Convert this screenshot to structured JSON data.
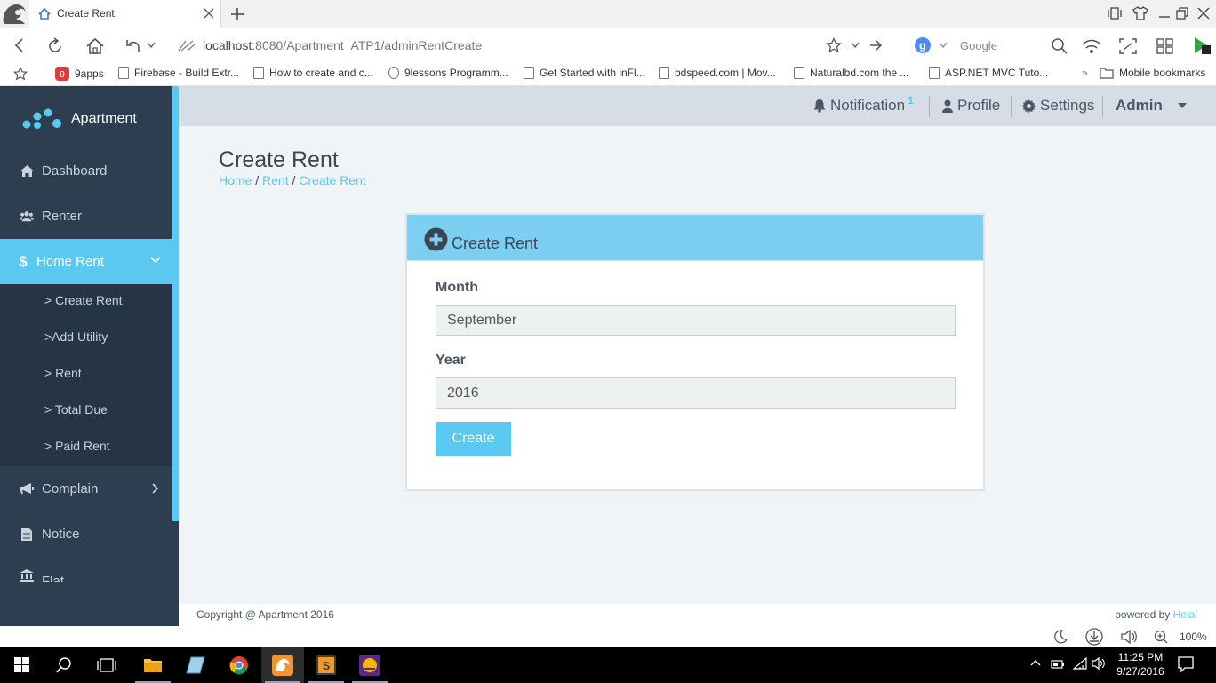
{
  "browser": {
    "tab_title": "Create Rent",
    "url": "localhost:8080/Apartment_ATP1/adminRentCreate",
    "url_host": "localhost",
    "url_rest": ":8080/Apartment_ATP1/adminRentCreate",
    "search_engine": "Google",
    "bookmarks": [
      "9apps",
      "Firebase - Build Extr...",
      "How to create and c...",
      "9lessons Programm...",
      "Get Started with inFl...",
      "bdspeed.com | Mov...",
      "Naturalbd.com the ...",
      "ASP.NET MVC Tuto..."
    ],
    "bookmarks_more": "»",
    "mobile_bookmarks": "Mobile bookmarks",
    "zoom": "100%"
  },
  "sidebar": {
    "brand": "Apartment",
    "items": [
      {
        "label": "Dashboard",
        "icon": "home-icon"
      },
      {
        "label": "Renter",
        "icon": "users-icon"
      },
      {
        "label": "Home Rent",
        "icon": "dollar-icon"
      },
      {
        "label": "Complain",
        "icon": "bullhorn-icon"
      },
      {
        "label": "Notice",
        "icon": "file-icon"
      },
      {
        "label": "Flat",
        "icon": "bank-icon"
      }
    ],
    "submenu": [
      "> Create Rent",
      ">Add Utility",
      "> Rent",
      "> Total Due",
      "> Paid Rent"
    ]
  },
  "topnav": {
    "notification": "Notification",
    "notification_count": "1",
    "profile": "Profile",
    "settings": "Settings",
    "admin": "Admin"
  },
  "page": {
    "title": "Create Rent",
    "breadcrumb": [
      "Home",
      "Rent",
      "Create Rent"
    ]
  },
  "form": {
    "panel_title": "Create Rent",
    "month_label": "Month",
    "month_value": "September",
    "year_label": "Year",
    "year_value": "2016",
    "submit": "Create"
  },
  "footer": {
    "copyright": "Copyright @ Apartment 2016",
    "powered_by": "powered by",
    "author": "Helal"
  },
  "taskbar": {
    "time": "11:25 PM",
    "date": "9/27/2016"
  },
  "colors": {
    "sidebar_bg": "#2c3e50",
    "accent": "#5ac8f1",
    "panel_header": "#7ccff0",
    "topnav_bg": "#d6dde6"
  }
}
